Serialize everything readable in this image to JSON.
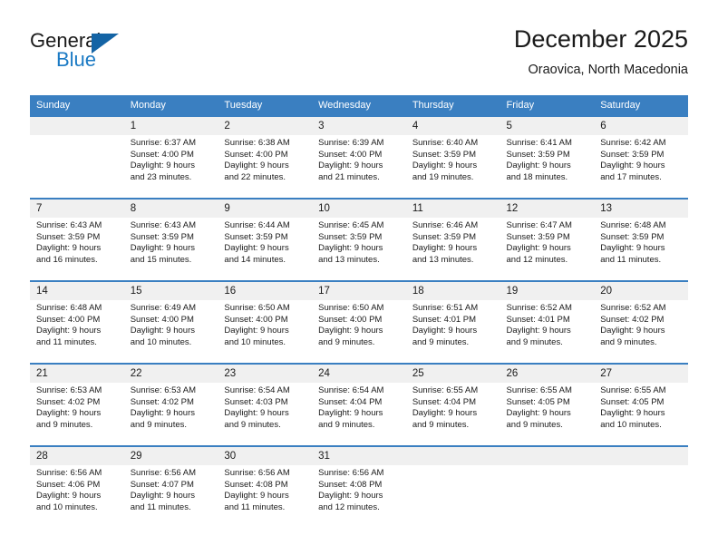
{
  "brand": {
    "name_part1": "General",
    "name_part2": "Blue",
    "triangle_color": "#1464a5",
    "blue_color": "#1b7ac4"
  },
  "header": {
    "title": "December 2025",
    "subtitle": "Oraovica, North Macedonia"
  },
  "theme": {
    "header_blue": "#3a7fc1",
    "daynum_band": "#f0f0f0",
    "text": "#1a1a1a"
  },
  "weekday_headers": [
    "Sunday",
    "Monday",
    "Tuesday",
    "Wednesday",
    "Thursday",
    "Friday",
    "Saturday"
  ],
  "weeks": [
    {
      "days": [
        {
          "num": "",
          "sunrise": "",
          "sunset": "",
          "daylight_line1": "",
          "daylight_line2": ""
        },
        {
          "num": "1",
          "sunrise": "Sunrise: 6:37 AM",
          "sunset": "Sunset: 4:00 PM",
          "daylight_line1": "Daylight: 9 hours",
          "daylight_line2": "and 23 minutes."
        },
        {
          "num": "2",
          "sunrise": "Sunrise: 6:38 AM",
          "sunset": "Sunset: 4:00 PM",
          "daylight_line1": "Daylight: 9 hours",
          "daylight_line2": "and 22 minutes."
        },
        {
          "num": "3",
          "sunrise": "Sunrise: 6:39 AM",
          "sunset": "Sunset: 4:00 PM",
          "daylight_line1": "Daylight: 9 hours",
          "daylight_line2": "and 21 minutes."
        },
        {
          "num": "4",
          "sunrise": "Sunrise: 6:40 AM",
          "sunset": "Sunset: 3:59 PM",
          "daylight_line1": "Daylight: 9 hours",
          "daylight_line2": "and 19 minutes."
        },
        {
          "num": "5",
          "sunrise": "Sunrise: 6:41 AM",
          "sunset": "Sunset: 3:59 PM",
          "daylight_line1": "Daylight: 9 hours",
          "daylight_line2": "and 18 minutes."
        },
        {
          "num": "6",
          "sunrise": "Sunrise: 6:42 AM",
          "sunset": "Sunset: 3:59 PM",
          "daylight_line1": "Daylight: 9 hours",
          "daylight_line2": "and 17 minutes."
        }
      ]
    },
    {
      "days": [
        {
          "num": "7",
          "sunrise": "Sunrise: 6:43 AM",
          "sunset": "Sunset: 3:59 PM",
          "daylight_line1": "Daylight: 9 hours",
          "daylight_line2": "and 16 minutes."
        },
        {
          "num": "8",
          "sunrise": "Sunrise: 6:43 AM",
          "sunset": "Sunset: 3:59 PM",
          "daylight_line1": "Daylight: 9 hours",
          "daylight_line2": "and 15 minutes."
        },
        {
          "num": "9",
          "sunrise": "Sunrise: 6:44 AM",
          "sunset": "Sunset: 3:59 PM",
          "daylight_line1": "Daylight: 9 hours",
          "daylight_line2": "and 14 minutes."
        },
        {
          "num": "10",
          "sunrise": "Sunrise: 6:45 AM",
          "sunset": "Sunset: 3:59 PM",
          "daylight_line1": "Daylight: 9 hours",
          "daylight_line2": "and 13 minutes."
        },
        {
          "num": "11",
          "sunrise": "Sunrise: 6:46 AM",
          "sunset": "Sunset: 3:59 PM",
          "daylight_line1": "Daylight: 9 hours",
          "daylight_line2": "and 13 minutes."
        },
        {
          "num": "12",
          "sunrise": "Sunrise: 6:47 AM",
          "sunset": "Sunset: 3:59 PM",
          "daylight_line1": "Daylight: 9 hours",
          "daylight_line2": "and 12 minutes."
        },
        {
          "num": "13",
          "sunrise": "Sunrise: 6:48 AM",
          "sunset": "Sunset: 3:59 PM",
          "daylight_line1": "Daylight: 9 hours",
          "daylight_line2": "and 11 minutes."
        }
      ]
    },
    {
      "days": [
        {
          "num": "14",
          "sunrise": "Sunrise: 6:48 AM",
          "sunset": "Sunset: 4:00 PM",
          "daylight_line1": "Daylight: 9 hours",
          "daylight_line2": "and 11 minutes."
        },
        {
          "num": "15",
          "sunrise": "Sunrise: 6:49 AM",
          "sunset": "Sunset: 4:00 PM",
          "daylight_line1": "Daylight: 9 hours",
          "daylight_line2": "and 10 minutes."
        },
        {
          "num": "16",
          "sunrise": "Sunrise: 6:50 AM",
          "sunset": "Sunset: 4:00 PM",
          "daylight_line1": "Daylight: 9 hours",
          "daylight_line2": "and 10 minutes."
        },
        {
          "num": "17",
          "sunrise": "Sunrise: 6:50 AM",
          "sunset": "Sunset: 4:00 PM",
          "daylight_line1": "Daylight: 9 hours",
          "daylight_line2": "and 9 minutes."
        },
        {
          "num": "18",
          "sunrise": "Sunrise: 6:51 AM",
          "sunset": "Sunset: 4:01 PM",
          "daylight_line1": "Daylight: 9 hours",
          "daylight_line2": "and 9 minutes."
        },
        {
          "num": "19",
          "sunrise": "Sunrise: 6:52 AM",
          "sunset": "Sunset: 4:01 PM",
          "daylight_line1": "Daylight: 9 hours",
          "daylight_line2": "and 9 minutes."
        },
        {
          "num": "20",
          "sunrise": "Sunrise: 6:52 AM",
          "sunset": "Sunset: 4:02 PM",
          "daylight_line1": "Daylight: 9 hours",
          "daylight_line2": "and 9 minutes."
        }
      ]
    },
    {
      "days": [
        {
          "num": "21",
          "sunrise": "Sunrise: 6:53 AM",
          "sunset": "Sunset: 4:02 PM",
          "daylight_line1": "Daylight: 9 hours",
          "daylight_line2": "and 9 minutes."
        },
        {
          "num": "22",
          "sunrise": "Sunrise: 6:53 AM",
          "sunset": "Sunset: 4:02 PM",
          "daylight_line1": "Daylight: 9 hours",
          "daylight_line2": "and 9 minutes."
        },
        {
          "num": "23",
          "sunrise": "Sunrise: 6:54 AM",
          "sunset": "Sunset: 4:03 PM",
          "daylight_line1": "Daylight: 9 hours",
          "daylight_line2": "and 9 minutes."
        },
        {
          "num": "24",
          "sunrise": "Sunrise: 6:54 AM",
          "sunset": "Sunset: 4:04 PM",
          "daylight_line1": "Daylight: 9 hours",
          "daylight_line2": "and 9 minutes."
        },
        {
          "num": "25",
          "sunrise": "Sunrise: 6:55 AM",
          "sunset": "Sunset: 4:04 PM",
          "daylight_line1": "Daylight: 9 hours",
          "daylight_line2": "and 9 minutes."
        },
        {
          "num": "26",
          "sunrise": "Sunrise: 6:55 AM",
          "sunset": "Sunset: 4:05 PM",
          "daylight_line1": "Daylight: 9 hours",
          "daylight_line2": "and 9 minutes."
        },
        {
          "num": "27",
          "sunrise": "Sunrise: 6:55 AM",
          "sunset": "Sunset: 4:05 PM",
          "daylight_line1": "Daylight: 9 hours",
          "daylight_line2": "and 10 minutes."
        }
      ]
    },
    {
      "days": [
        {
          "num": "28",
          "sunrise": "Sunrise: 6:56 AM",
          "sunset": "Sunset: 4:06 PM",
          "daylight_line1": "Daylight: 9 hours",
          "daylight_line2": "and 10 minutes."
        },
        {
          "num": "29",
          "sunrise": "Sunrise: 6:56 AM",
          "sunset": "Sunset: 4:07 PM",
          "daylight_line1": "Daylight: 9 hours",
          "daylight_line2": "and 11 minutes."
        },
        {
          "num": "30",
          "sunrise": "Sunrise: 6:56 AM",
          "sunset": "Sunset: 4:08 PM",
          "daylight_line1": "Daylight: 9 hours",
          "daylight_line2": "and 11 minutes."
        },
        {
          "num": "31",
          "sunrise": "Sunrise: 6:56 AM",
          "sunset": "Sunset: 4:08 PM",
          "daylight_line1": "Daylight: 9 hours",
          "daylight_line2": "and 12 minutes."
        },
        {
          "num": "",
          "sunrise": "",
          "sunset": "",
          "daylight_line1": "",
          "daylight_line2": ""
        },
        {
          "num": "",
          "sunrise": "",
          "sunset": "",
          "daylight_line1": "",
          "daylight_line2": ""
        },
        {
          "num": "",
          "sunrise": "",
          "sunset": "",
          "daylight_line1": "",
          "daylight_line2": ""
        }
      ]
    }
  ]
}
